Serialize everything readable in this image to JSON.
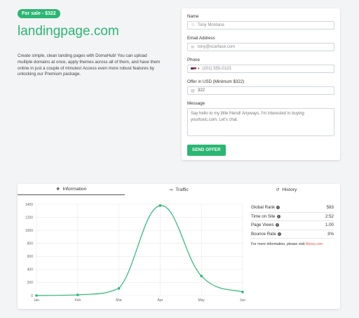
{
  "hero": {
    "badge": "For sale - $322",
    "title": "landingpage.com",
    "description": "Create simple, clean landing pages with DomaHub! You can upload multiple domains at once, apply themes across all of them, and have them online in just a couple of minutes! Access even more robust features by unlocking our Premium package."
  },
  "form": {
    "name_label": "Name",
    "name_value": "Tony Montana",
    "email_label": "Email Address",
    "email_value": "tony@scarface.com",
    "phone_label": "Phone",
    "phone_value": "(201) 555-0123",
    "offer_label": "Offer in USD (Minimum $322)",
    "offer_value": "322",
    "message_label": "Message",
    "message_placeholder": "Say hello to my little friend! Anyways, I'm interested in buying yourtoxic.com. Let's chat.",
    "send_label": "SEND OFFER"
  },
  "tabs": [
    {
      "label": "Information",
      "icon": "info-circle-icon"
    },
    {
      "label": "Traffic",
      "icon": "chart-icon"
    },
    {
      "label": "History",
      "icon": "history-icon"
    }
  ],
  "metrics": {
    "rows": [
      {
        "label": "Global Rank",
        "value": "583"
      },
      {
        "label": "Time on Site",
        "value": "2:52"
      },
      {
        "label": "Page Views",
        "value": "1.00"
      },
      {
        "label": "Bounce Rate",
        "value": "3%"
      }
    ],
    "more_text": "For more information, please visit",
    "more_link": "Alexa.com"
  },
  "colors": {
    "accent": "#2bb673",
    "link": "#e8543f"
  },
  "chart_data": {
    "type": "line",
    "categories": [
      "Jan",
      "Feb",
      "Mar",
      "Apr",
      "May",
      "Jun"
    ],
    "series": [
      {
        "values": [
          0,
          10,
          110,
          1380,
          300,
          55
        ]
      }
    ],
    "ylim": [
      0,
      1400
    ],
    "yticks": [
      0,
      200,
      400,
      600,
      800,
      1000,
      1200,
      1400
    ],
    "grid": true
  }
}
